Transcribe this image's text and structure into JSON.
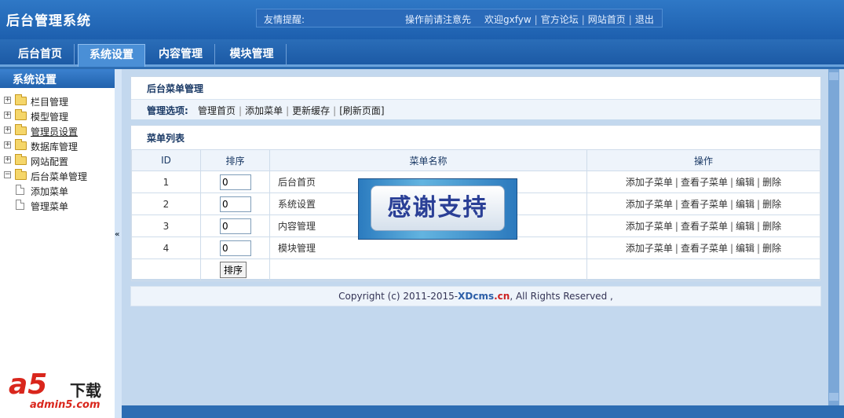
{
  "header": {
    "app_title": "后台管理系统",
    "notice_label": "友情提醒:",
    "notice_text": "操作前请注意先",
    "welcome": "欢迎gxfyw",
    "links": [
      "官方论坛",
      "网站首页",
      "退出"
    ]
  },
  "nav": {
    "tabs": [
      "后台首页",
      "系统设置",
      "内容管理",
      "模块管理"
    ],
    "active_tab": "系统设置"
  },
  "sidebar": {
    "title": "系统设置",
    "items": [
      "栏目管理",
      "模型管理",
      "管理员设置",
      "数据库管理",
      "网站配置",
      "后台菜单管理"
    ],
    "sub_items": [
      "添加菜单",
      "管理菜单"
    ],
    "collapse_symbol": "«"
  },
  "menu_panel": {
    "title": "后台菜单管理",
    "options_label": "管理选项:",
    "options": [
      "管理首页",
      "添加菜单",
      "更新缓存",
      "[刷新页面]"
    ]
  },
  "list_panel": {
    "title": "菜单列表",
    "columns": [
      "ID",
      "排序",
      "菜单名称",
      "操作"
    ],
    "rows": [
      {
        "id": "1",
        "sort": "0",
        "name": "后台首页"
      },
      {
        "id": "2",
        "sort": "0",
        "name": "系统设置"
      },
      {
        "id": "3",
        "sort": "0",
        "name": "内容管理"
      },
      {
        "id": "4",
        "sort": "0",
        "name": "模块管理"
      }
    ],
    "actions": [
      "添加子菜单",
      "查看子菜单",
      "编辑",
      "删除"
    ],
    "sort_button": "排序"
  },
  "footer": {
    "prefix": "Copyright (c) 2011-2015-",
    "brand_x": "XDcms",
    "brand_cn": ".cn",
    "suffix": ", All Rights Reserved ,"
  },
  "overlay": {
    "text": "感谢支持"
  },
  "logo": {
    "mark": "a5",
    "download": "下载",
    "site": "admin5.com"
  },
  "colors": {
    "header": "#1d5fae",
    "accent": "#2d6db3",
    "panel_bg": "#c3d8ee",
    "brand_red": "#d9261c"
  }
}
